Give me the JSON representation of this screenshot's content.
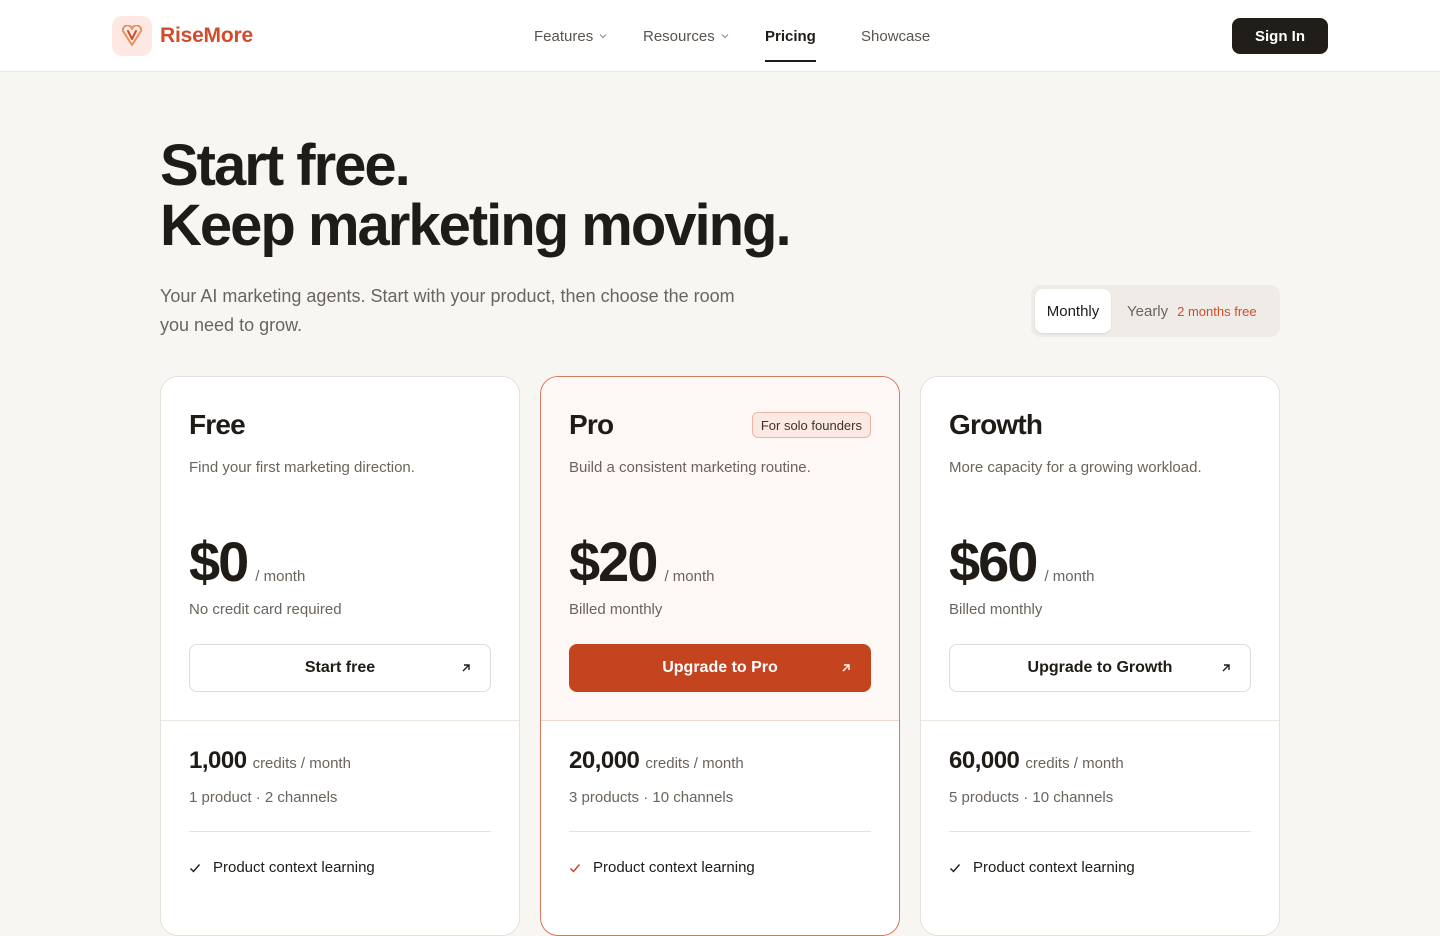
{
  "brand": {
    "name": "RiseMore",
    "logo_icon": "heart-v-icon",
    "accent": "#d24c2b"
  },
  "nav": {
    "links": [
      {
        "label": "Features",
        "has_dropdown": true
      },
      {
        "label": "Resources",
        "has_dropdown": true
      },
      {
        "label": "Pricing",
        "active": true
      },
      {
        "label": "Showcase"
      }
    ],
    "signin_label": "Sign In"
  },
  "hero": {
    "title_line1": "Start free.",
    "title_line2": "Keep marketing moving.",
    "subtitle": "Your AI marketing agents. Start with your product, then choose the room you need to grow."
  },
  "billing": {
    "monthly": "Monthly",
    "yearly": "Yearly",
    "yearly_badge": "2 months free",
    "selected": "Monthly"
  },
  "plans": [
    {
      "name": "Free",
      "tag": "",
      "description": "Find your first marketing direction.",
      "price": "$0",
      "period": "/ month",
      "note": "No credit card required",
      "cta": "Start free",
      "credits": "1,000",
      "credits_unit": "credits / month",
      "limits": "1 product · 2 channels",
      "features": [
        "Product context learning"
      ]
    },
    {
      "name": "Pro",
      "tag": "For solo founders",
      "description": "Build a consistent marketing routine.",
      "price": "$20",
      "period": "/ month",
      "note": "Billed monthly",
      "cta": "Upgrade to Pro",
      "credits": "20,000",
      "credits_unit": "credits / month",
      "limits": "3 products · 10 channels",
      "features": [
        "Product context learning"
      ]
    },
    {
      "name": "Growth",
      "tag": "",
      "description": "More capacity for a growing workload.",
      "price": "$60",
      "period": "/ month",
      "note": "Billed monthly",
      "cta": "Upgrade to Growth",
      "credits": "60,000",
      "credits_unit": "credits / month",
      "limits": "5 products · 10 channels",
      "features": [
        "Product context learning"
      ]
    }
  ],
  "colors": {
    "primary_button": "#c4441f",
    "dark_button": "#211d19",
    "background": "#f8f6f2"
  }
}
